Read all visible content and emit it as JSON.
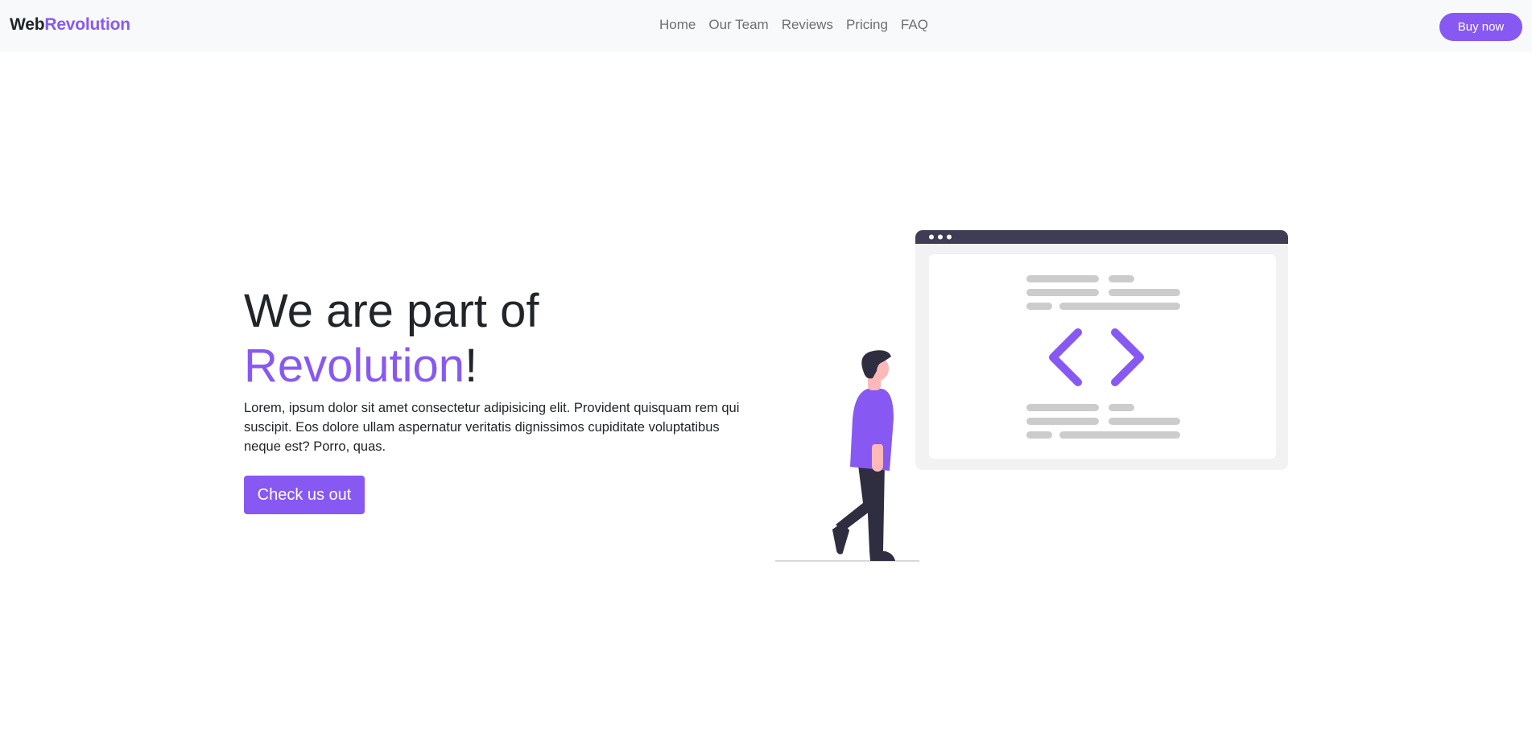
{
  "navbar": {
    "brand_prefix": "Web",
    "brand_accent": "Revolution",
    "links": [
      "Home",
      "Our Team",
      "Reviews",
      "Pricing",
      "FAQ"
    ],
    "cta_label": "Buy now"
  },
  "hero": {
    "title_line1": "We are part of",
    "title_accent": "Revolution",
    "title_suffix": "!",
    "description": "Lorem, ipsum dolor sit amet consectetur adipisicing elit. Provident quisquam rem qui suscipit. Eos dolore ullam aspernatur veritatis dignissimos cupiditate voluptatibus neque est? Porro, quas.",
    "cta_label": "Check us out"
  },
  "illustration": {
    "icon": "code-brackets-icon",
    "figure": "walking-person"
  },
  "colors": {
    "accent": "#8759f2",
    "navbar_bg": "#f8f9fa",
    "text": "#212529",
    "window_bar": "#3f3d56"
  }
}
